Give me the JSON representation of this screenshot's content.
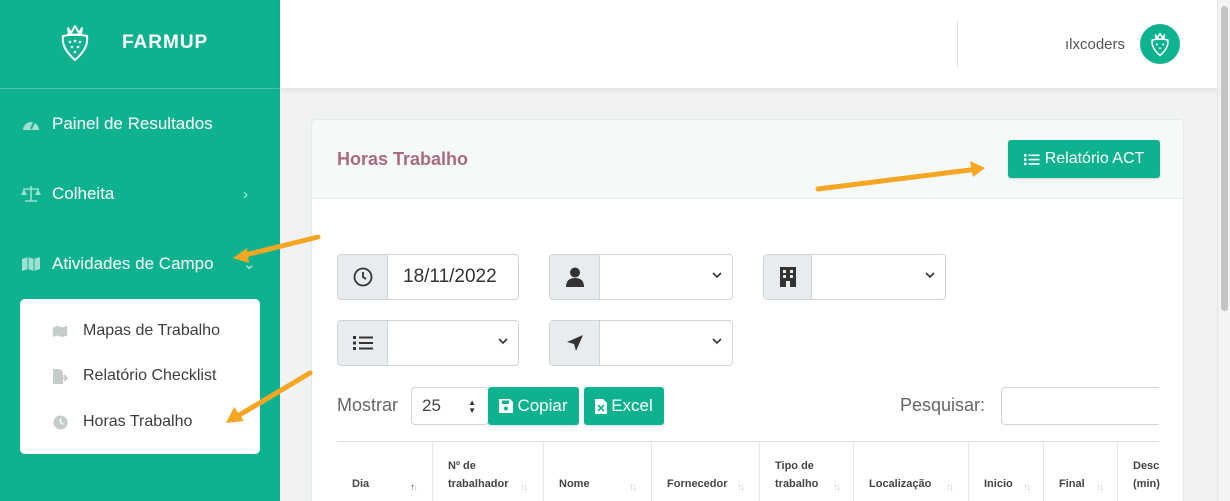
{
  "brand": {
    "name": "FARMUP"
  },
  "sidebar": {
    "items": [
      {
        "label": "Painel de Resultados",
        "icon": "gauge-icon"
      },
      {
        "label": "Colheita",
        "icon": "balance-scale-icon",
        "chevron": "›"
      },
      {
        "label": "Atividades de Campo",
        "icon": "map-icon",
        "chevron": "⌄"
      }
    ],
    "submenu": [
      {
        "label": "Mapas de Trabalho",
        "icon": "map-icon"
      },
      {
        "label": "Relatório Checklist",
        "icon": "file-export-icon"
      },
      {
        "label": "Horas Trabalho",
        "icon": "clock-icon"
      }
    ]
  },
  "topbar": {
    "username": "ılxcoders"
  },
  "card": {
    "title": "Horas Trabalho",
    "report_button": "Relatório ACT"
  },
  "filters": {
    "date_value": "18/11/2022",
    "worker_value": "",
    "building_value": "",
    "list_value": "",
    "location_value": ""
  },
  "table_controls": {
    "show_label": "Mostrar",
    "page_length": "25",
    "copy_button": "Copiar",
    "excel_button": "Excel",
    "search_label": "Pesquisar:"
  },
  "table": {
    "columns": [
      {
        "line1": "Dia",
        "line2": ""
      },
      {
        "line1": "Nº de",
        "line2": "trabalhador"
      },
      {
        "line1": "Nome",
        "line2": ""
      },
      {
        "line1": "Fornecedor",
        "line2": ""
      },
      {
        "line1": "Tipo de",
        "line2": "trabalho"
      },
      {
        "line1": "Localização",
        "line2": ""
      },
      {
        "line1": "Inicio",
        "line2": ""
      },
      {
        "line1": "Final",
        "line2": ""
      },
      {
        "line1": "Desc",
        "line2": "(min)"
      }
    ]
  },
  "colors": {
    "primary": "#0fb28f",
    "title": "#a96a80",
    "annotation_arrow": "#f5a623"
  }
}
